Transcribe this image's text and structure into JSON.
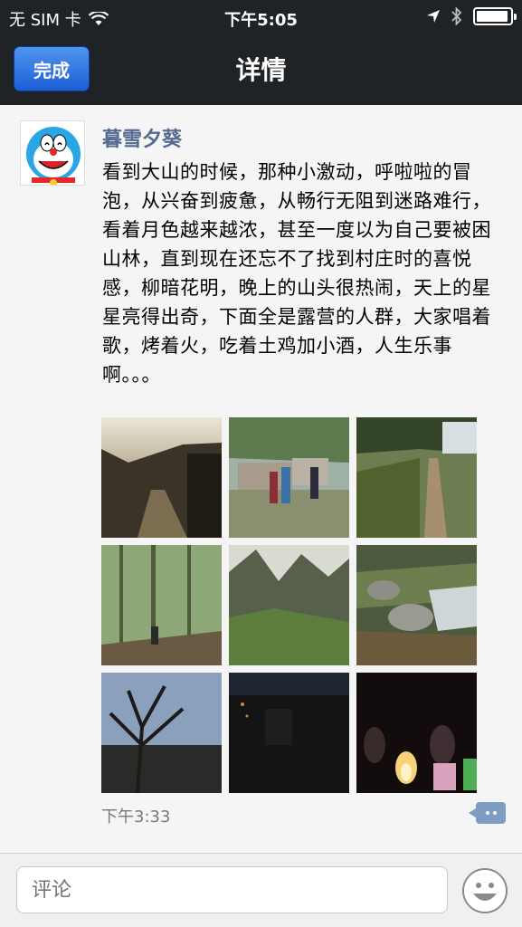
{
  "status_bar": {
    "carrier": "无 SIM 卡",
    "time": "下午5:05"
  },
  "nav": {
    "done_label": "完成",
    "title": "详情"
  },
  "post": {
    "username": "暮雪夕葵",
    "text": "看到大山的时候，那种小激动，呼啦啦的冒泡，从兴奋到疲惫，从畅行无阻到迷路难行，看着月色越来越浓，甚至一度以为自己要被困山林，直到现在还忘不了找到村庄时的喜悦感，柳暗花明，晚上的山头很热闹，天上的星星亮得出奇，下面全是露营的人群，大家唱着歌，烤着火，吃着土鸡加小酒，人生乐事啊。。。",
    "timestamp": "下午3:33",
    "photos": [
      {
        "name": "sunset-path"
      },
      {
        "name": "village-hikers"
      },
      {
        "name": "field-trail"
      },
      {
        "name": "forest-hiker"
      },
      {
        "name": "mountain-valley"
      },
      {
        "name": "stream-rocks"
      },
      {
        "name": "dusk-tree"
      },
      {
        "name": "night-village"
      },
      {
        "name": "campfire-night"
      }
    ]
  },
  "comment_bar": {
    "placeholder": "评论"
  },
  "colors": {
    "bar_bg": "#202325",
    "accent_blue": "#1d5ed8",
    "username": "#53698f"
  }
}
